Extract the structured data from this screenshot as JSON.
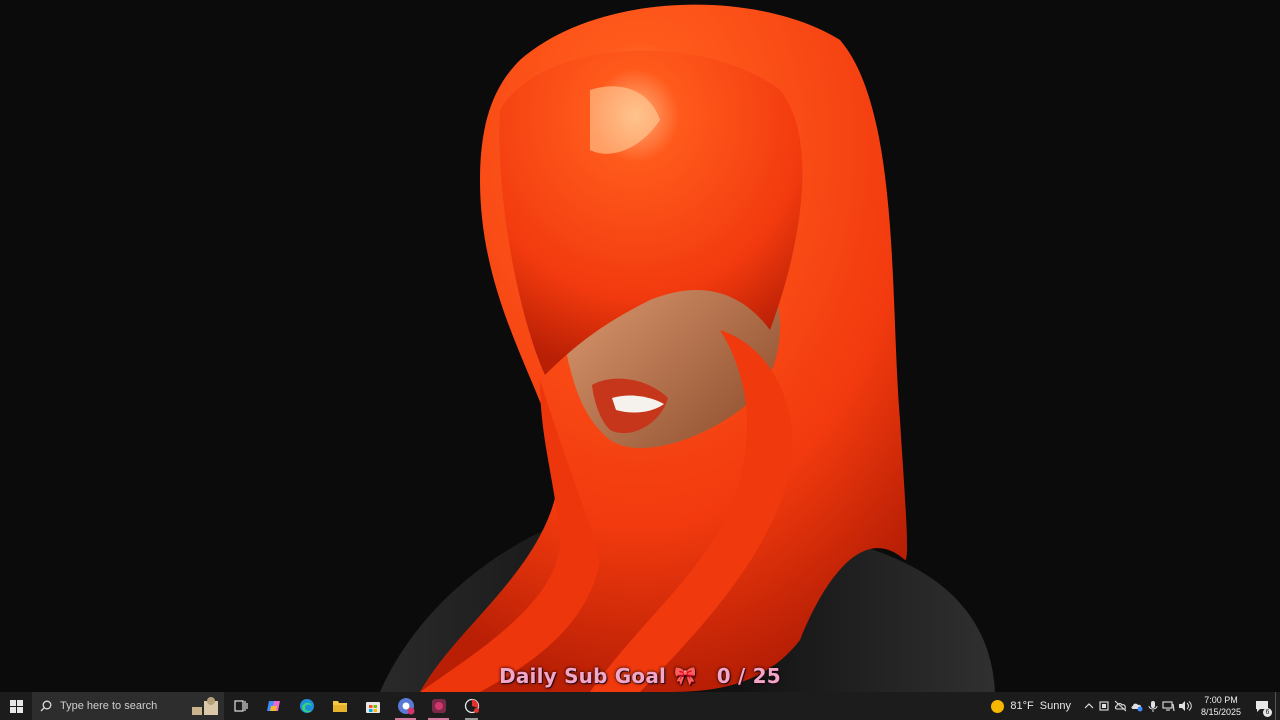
{
  "overlay": {
    "goal_label": "Daily Sub Goal",
    "goal_icon": "ribbon-bow-icon",
    "goal_count": "0 / 25"
  },
  "taskbar": {
    "search_placeholder": "Type here to search",
    "apps": [
      {
        "name": "task-view-icon"
      },
      {
        "name": "copilot-icon"
      },
      {
        "name": "edge-browser-icon"
      },
      {
        "name": "file-explorer-icon"
      },
      {
        "name": "microsoft-store-icon"
      },
      {
        "name": "chrome-profile-icon"
      },
      {
        "name": "app-pink-icon"
      },
      {
        "name": "app-red-dial-icon"
      }
    ],
    "weather_temp": "81°F",
    "weather_condition": "Sunny",
    "clock_time": "7:00 PM",
    "clock_date": "8/15/2025",
    "notification_count": "6"
  },
  "colors": {
    "hair": "#ff3d12",
    "goal_text": "#f4a6c8",
    "taskbar": "#1c1c1c"
  }
}
